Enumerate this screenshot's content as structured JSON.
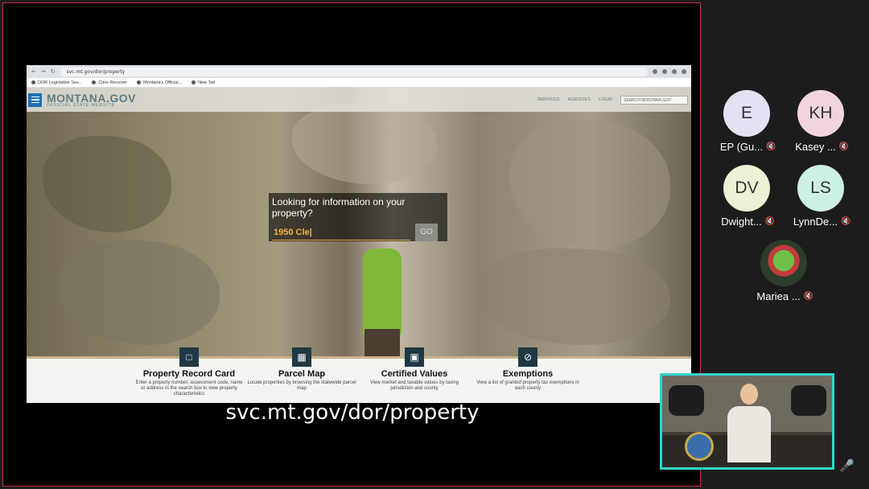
{
  "browser": {
    "url": "svc.mt.gov/dor/property",
    "bookmarks": [
      "DOR Legislative Ses...",
      "Citrix Receiver",
      "Montana's Official...",
      "New Tab"
    ]
  },
  "site": {
    "logo_main": "MONTANA.GOV",
    "logo_sub": "OFFICIAL STATE WEBSITE",
    "nav": [
      "SERVICES",
      "AGENCIES",
      "LOGIN"
    ],
    "search_placeholder": "SEARCH MONTANA.GOV",
    "lookup_question": "Looking for information on your property?",
    "lookup_value": "1950 Cle|",
    "go_label": "GO",
    "cards": [
      {
        "title": "Property Record Card",
        "desc": "Enter a property number, assessment code, name or address in the search box to view property characteristics",
        "icon": "document-icon"
      },
      {
        "title": "Parcel Map",
        "desc": "Locate properties by browsing the statewide parcel map",
        "icon": "map-icon"
      },
      {
        "title": "Certified Values",
        "desc": "View market and taxable values by taxing jurisdiction and county",
        "icon": "monitor-icon"
      },
      {
        "title": "Exemptions",
        "desc": "View a list of granted property tax exemptions in each county",
        "icon": "prohibited-icon"
      }
    ]
  },
  "caption": "svc.mt.gov/dor/property",
  "participants": [
    {
      "initials": "E",
      "name": "EP (Gu...",
      "color": "#e4e2f2"
    },
    {
      "initials": "KH",
      "name": "Kasey ...",
      "color": "#f2d5dc"
    },
    {
      "initials": "DV",
      "name": "Dwight...",
      "color": "#eef0d6"
    },
    {
      "initials": "LS",
      "name": "LynnDe...",
      "color": "#cdf0e4"
    },
    {
      "initials": "",
      "name": "Mariea ...",
      "color": "#2c3d2a"
    }
  ],
  "colors": {
    "accent_border": "#2ed6c8",
    "share_border": "#c8304a"
  }
}
